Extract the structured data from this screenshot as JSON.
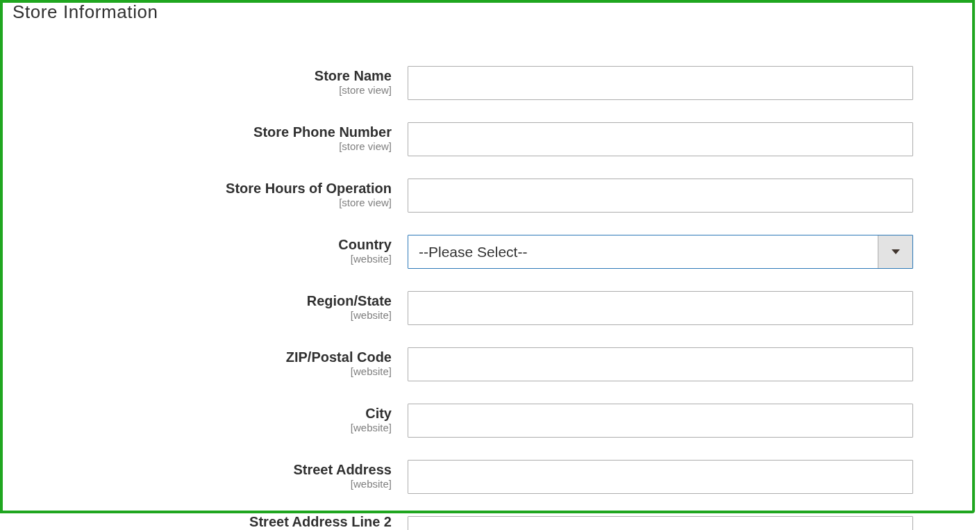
{
  "highlighted_section": {
    "title": "Store Information",
    "fields": [
      {
        "label": "Store Name",
        "scope": "[store view]",
        "kind": "text",
        "focused": false
      },
      {
        "label": "Store Phone Number",
        "scope": "[store view]",
        "kind": "text",
        "focused": false
      },
      {
        "label": "Store Hours of Operation",
        "scope": "[store view]",
        "kind": "text",
        "focused": false
      },
      {
        "label": "Country",
        "scope": "[website]",
        "kind": "select",
        "value": "--Please Select--",
        "focused": true
      },
      {
        "label": "Region/State",
        "scope": "[website]",
        "kind": "text",
        "focused": false
      },
      {
        "label": "ZIP/Postal Code",
        "scope": "[website]",
        "kind": "text",
        "focused": false
      },
      {
        "label": "City",
        "scope": "[website]",
        "kind": "text",
        "focused": false
      },
      {
        "label": "Street Address",
        "scope": "[website]",
        "kind": "text",
        "focused": false
      }
    ]
  },
  "below_frame": {
    "fields": [
      {
        "label": "Street Address Line 2",
        "kind": "text",
        "focused": false
      }
    ]
  }
}
